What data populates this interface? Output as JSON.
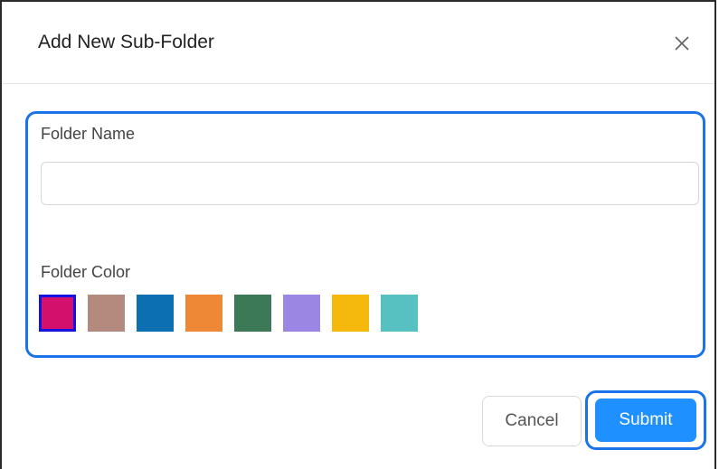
{
  "dialog": {
    "title": "Add New Sub-Folder",
    "close_icon": "close-icon"
  },
  "form": {
    "folder_name_label": "Folder Name",
    "folder_name_value": "",
    "folder_name_placeholder": "",
    "folder_color_label": "Folder Color",
    "colors": [
      {
        "name": "magenta",
        "hex": "#d3106c",
        "selected": true
      },
      {
        "name": "rose-brown",
        "hex": "#b58a7e",
        "selected": false
      },
      {
        "name": "blue",
        "hex": "#0b6fb2",
        "selected": false
      },
      {
        "name": "orange",
        "hex": "#ee8836",
        "selected": false
      },
      {
        "name": "green",
        "hex": "#3c7a57",
        "selected": false
      },
      {
        "name": "lavender",
        "hex": "#9b87e3",
        "selected": false
      },
      {
        "name": "yellow",
        "hex": "#f4b90c",
        "selected": false
      },
      {
        "name": "teal",
        "hex": "#56c1c0",
        "selected": false
      }
    ],
    "accent_color": "#1a73e8"
  },
  "footer": {
    "cancel_label": "Cancel",
    "submit_label": "Submit"
  }
}
